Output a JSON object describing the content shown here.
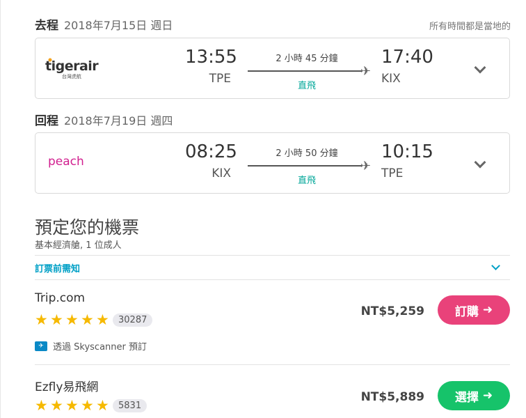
{
  "timezone_note": "所有時間都是當地的",
  "legs": [
    {
      "direction": "去程",
      "date": "2018年7月15日  週日",
      "airline": "tigerair",
      "airline_sub": "台灣虎航",
      "dep_time": "13:55",
      "dep_code": "TPE",
      "duration": "2 小時 45 分鐘",
      "stops": "直飛",
      "arr_time": "17:40",
      "arr_code": "KIX"
    },
    {
      "direction": "回程",
      "date": "2018年7月19日  週四",
      "airline": "peach",
      "airline_sub": "",
      "dep_time": "08:25",
      "dep_code": "KIX",
      "duration": "2 小時 50 分鐘",
      "stops": "直飛",
      "arr_time": "10:15",
      "arr_code": "TPE"
    }
  ],
  "booking": {
    "title": "預定您的機票",
    "subtitle": "基本經濟艙, 1 位成人",
    "notice_label": "訂票前需知"
  },
  "providers": [
    {
      "name": "Trip.com",
      "stars": 5,
      "reviews": "30287",
      "via": "透過 Skyscanner 預訂",
      "price": "NT$5,259",
      "button": "訂購"
    },
    {
      "name": "Ezfly易飛網",
      "stars": 5,
      "reviews": "5831",
      "via": "",
      "price": "NT$5,889",
      "button": "選擇"
    }
  ],
  "colors": {
    "accent_teal": "#00a698",
    "link_blue": "#00a0c6",
    "star": "#f6b900",
    "book_pink": "#e9427a",
    "select_green": "#16c36a",
    "tiger_orange": "#f4a21c",
    "peach_magenta": "#d1208f"
  }
}
